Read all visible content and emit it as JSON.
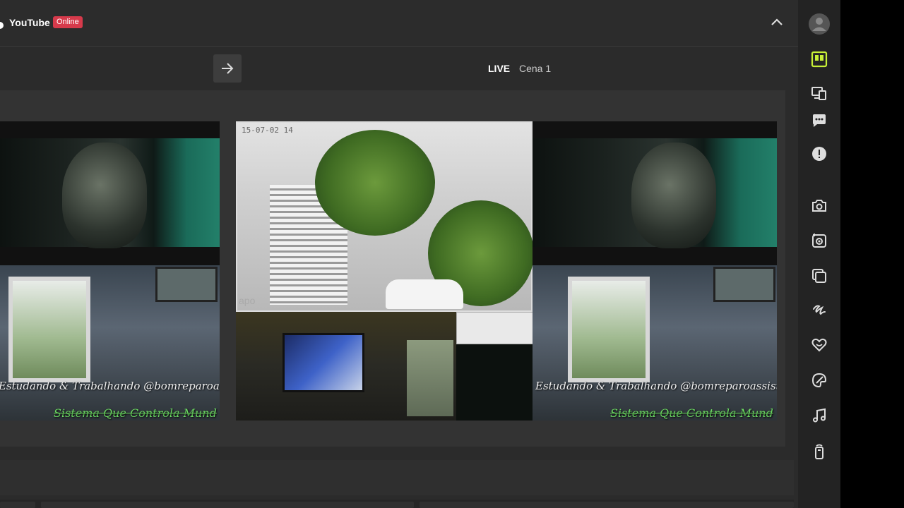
{
  "header": {
    "platform": "YouTube",
    "status_badge": "Online"
  },
  "scene_bar": {
    "live_label": "LIVE",
    "scene_name": "Cena 1"
  },
  "preview": {
    "caption_study": "Estudando & Trabalhando @bomreparoassistenc",
    "caption_system": "Sistema Que Controla Mund",
    "camera_timestamp": "15-07-02 14",
    "camera_logo": "apo"
  },
  "dock": {
    "icons": [
      "avatar-icon",
      "layout-icon",
      "devices-icon",
      "chat-icon",
      "alert-icon",
      "camera-icon",
      "snapshot-icon",
      "layers-icon",
      "scribble-icon",
      "heart-icon",
      "palette-icon",
      "music-icon",
      "remote-icon"
    ]
  },
  "colors": {
    "accent": "#c7f037",
    "badge": "#d63a4b",
    "panel_bg": "#2b2b2b"
  }
}
